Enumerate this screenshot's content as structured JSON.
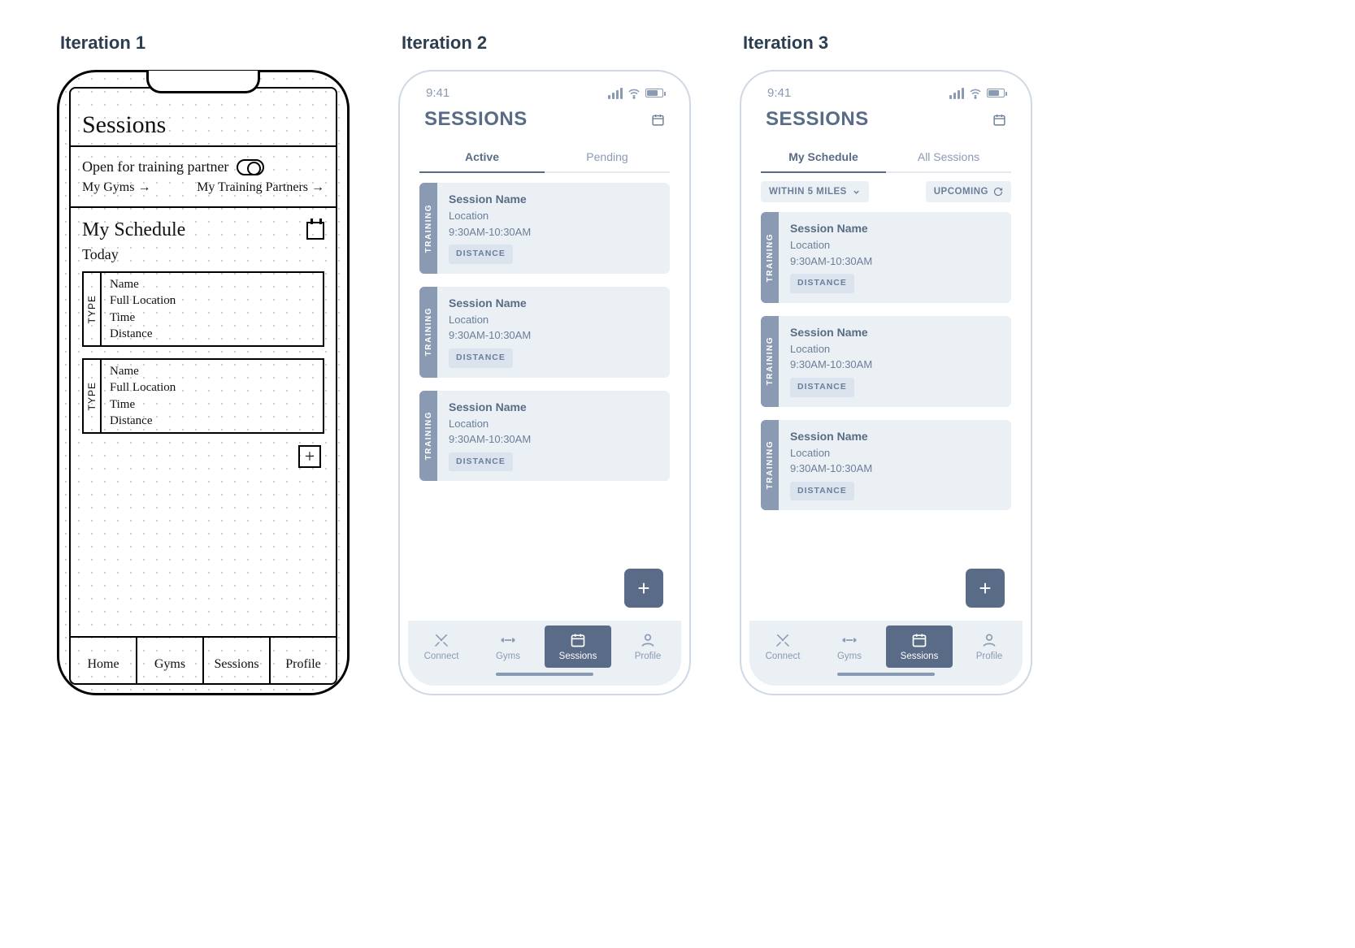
{
  "headings": {
    "i1": "Iteration 1",
    "i2": "Iteration 2",
    "i3": "Iteration 3"
  },
  "it1": {
    "title": "Sessions",
    "toggleLabel": "Open for training partner",
    "links": {
      "gyms": "My Gyms",
      "partners": "My Training Partners"
    },
    "schedule": {
      "title": "My Schedule",
      "today": "Today"
    },
    "card": {
      "tag": "TYPE",
      "name": "Name",
      "loc": "Full Location",
      "time": "Time",
      "dist": "Distance"
    },
    "nav": [
      "Home",
      "Gyms",
      "Sessions",
      "Profile"
    ]
  },
  "common": {
    "status": {
      "time": "9:41"
    },
    "header": "SESSIONS",
    "card": {
      "tag": "TRAINING",
      "name": "Session Name",
      "loc": "Location",
      "time": "9:30AM-10:30AM",
      "dist": "DISTANCE"
    },
    "fab": "+",
    "nav": [
      {
        "id": "connect",
        "label": "Connect"
      },
      {
        "id": "gyms",
        "label": "Gyms"
      },
      {
        "id": "sessions",
        "label": "Sessions"
      },
      {
        "id": "profile",
        "label": "Profile"
      }
    ]
  },
  "it2": {
    "tabs": [
      "Active",
      "Pending"
    ]
  },
  "it3": {
    "tabs": [
      "My Schedule",
      "All Sessions"
    ],
    "filters": {
      "distance": "WITHIN 5 MILES",
      "sort": "UPCOMING"
    }
  }
}
